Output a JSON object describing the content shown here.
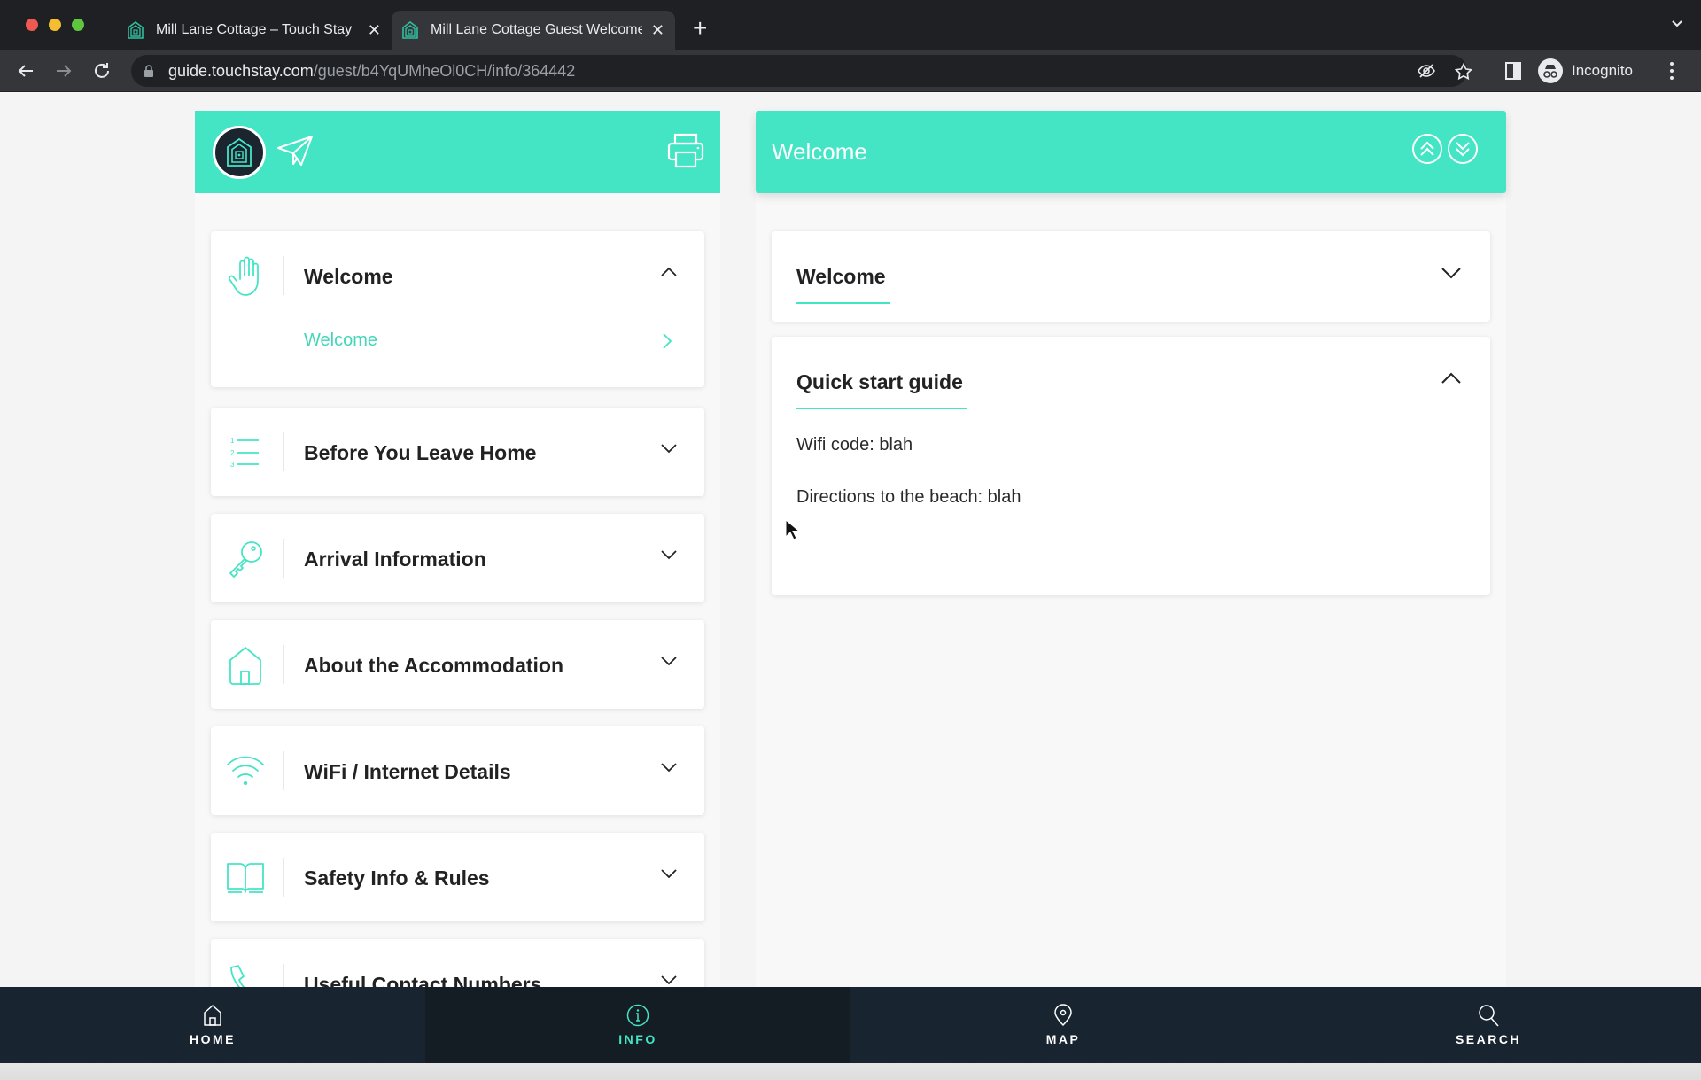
{
  "browser": {
    "tabs": [
      {
        "title": "Mill Lane Cottage – Touch Stay",
        "active": false
      },
      {
        "title": "Mill Lane Cottage Guest Welcome",
        "active": true
      }
    ],
    "new_tab_label": "+",
    "url_host": "guide.touchstay.com",
    "url_path": "/guest/b4YqUMheOl0CH/info/364442",
    "profile_label": "Incognito"
  },
  "sidebar": {
    "header_icons": [
      "touchstay-logo-icon",
      "send-icon",
      "print-icon"
    ],
    "categories": [
      {
        "label": "Welcome",
        "icon": "hand-icon",
        "expanded": true,
        "items": [
          {
            "label": "Welcome"
          }
        ]
      },
      {
        "label": "Before You Leave Home",
        "icon": "numbered-list-icon",
        "expanded": false
      },
      {
        "label": "Arrival Information",
        "icon": "key-icon",
        "expanded": false
      },
      {
        "label": "About the Accommodation",
        "icon": "house-icon",
        "expanded": false
      },
      {
        "label": "WiFi / Internet Details",
        "icon": "wifi-icon",
        "expanded": false
      },
      {
        "label": "Safety Info & Rules",
        "icon": "book-icon",
        "expanded": false
      },
      {
        "label": "Useful Contact Numbers",
        "icon": "phone-icon",
        "expanded": false
      }
    ]
  },
  "content": {
    "title": "Welcome",
    "sections": [
      {
        "title": "Welcome",
        "expanded": false,
        "lines": []
      },
      {
        "title": "Quick start guide",
        "expanded": true,
        "lines": [
          "Wifi code: blah",
          "Directions to the beach: blah"
        ]
      }
    ]
  },
  "bottom_nav": {
    "items": [
      {
        "label": "HOME",
        "icon": "home-icon",
        "active": false
      },
      {
        "label": "INFO",
        "icon": "info-icon",
        "active": true
      },
      {
        "label": "MAP",
        "icon": "map-pin-icon",
        "active": false
      },
      {
        "label": "SEARCH",
        "icon": "search-icon",
        "active": false
      }
    ]
  },
  "colors": {
    "accent": "#44e5c5",
    "nav_bg": "#182531",
    "text": "#222222"
  }
}
